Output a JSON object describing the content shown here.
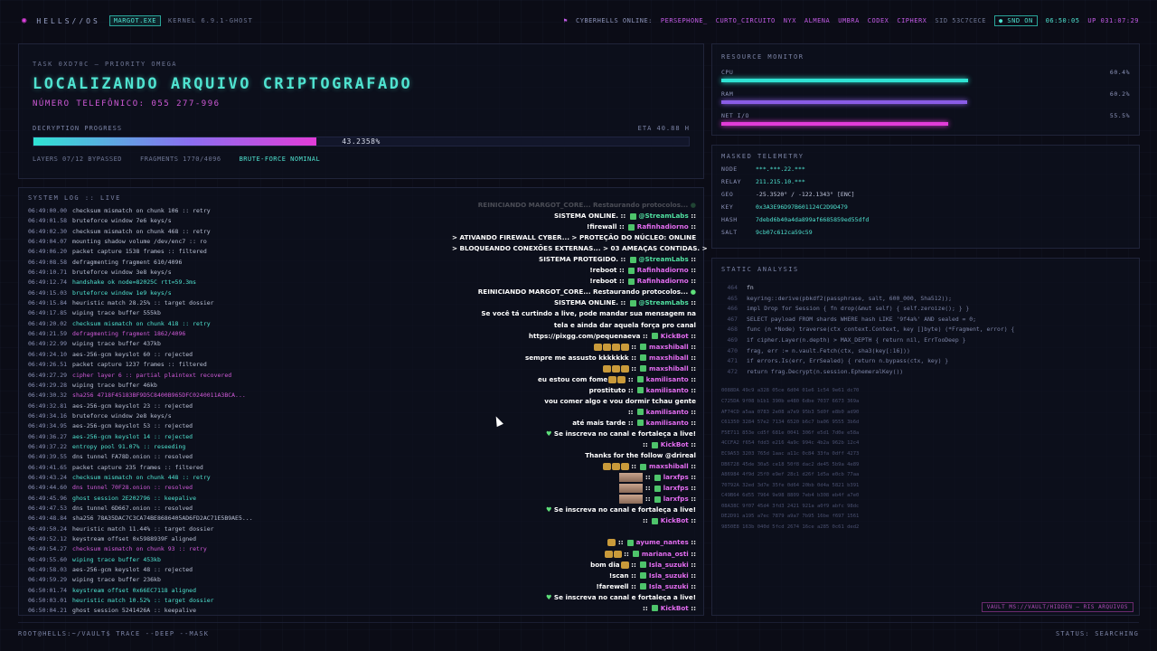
{
  "topbar": {
    "brand": "HELLS//OS",
    "process": "MARGOT.EXE",
    "kernel": "KERNEL 6.9.1-GHOST",
    "online_label": "CYBERHELLS ONLINE:",
    "users": [
      "PERSEPHONE_",
      "CURTO_CIRCUITO",
      "NYX",
      "ALMENA",
      "UMBRA",
      "CODEX",
      "CIPHERX"
    ],
    "sid": "SID 53C7CECE",
    "snd": "SND ON",
    "clock": "06:50:05",
    "uptime": "UP 031:07:29"
  },
  "task": {
    "id": "TASK 0XD70C — PRIORITY OMEGA",
    "headline": "LOCALIZANDO ARQUIVO CRIPTOGRAFADO",
    "phone": "NÚMERO TELEFÔNICO: 055 277-996",
    "progress_label": "DECRYPTION PROGRESS",
    "eta": "ETA 40.88 H",
    "progress_pct": 43.2358,
    "progress_text": "43.2358%",
    "layers": "LAYERS 07/12 BYPASSED",
    "fragments": "FRAGMENTS 1770/4096",
    "status": "BRUTE-FORCE NOMINAL"
  },
  "resources": {
    "title": "RESOURCE MONITOR",
    "items": [
      {
        "label": "CPU",
        "value": "60.4%",
        "level": 0.604,
        "color": "#2fe3d3"
      },
      {
        "label": "RAM",
        "value": "60.2%",
        "level": 0.602,
        "color": "#8a5ce6"
      },
      {
        "label": "NET I/O",
        "value": "55.5%",
        "level": 0.555,
        "color": "#e23cd8"
      }
    ]
  },
  "telemetry": {
    "title": "MASKED TELEMETRY",
    "rows": [
      {
        "key": "NODE",
        "value": "***.***.22.***"
      },
      {
        "key": "RELAY",
        "value": "211.215.10.***"
      },
      {
        "key": "GEO",
        "value": "-25.3520° / -122.1343° [ENC]"
      },
      {
        "key": "KEY",
        "value": "0x3A3E96D97B601124C2D9D479"
      },
      {
        "key": "HASH",
        "value": "7debd6b40a4da899af6685859ed55dfd"
      },
      {
        "key": "SALT",
        "value": "9cb07c612ca59c59"
      }
    ]
  },
  "static_analysis": {
    "title": "STATIC ANALYSIS",
    "lines": [
      {
        "n": "464",
        "t": "fn"
      },
      {
        "n": "465",
        "t": "keyring::derive(pbkdf2(passphrase, salt, 600_000, Sha512));"
      },
      {
        "n": "466",
        "t": "impl Drop for Session { fn drop(&mut self) { self.zeroize(); } }"
      },
      {
        "n": "467",
        "t": "SELECT payload FROM shards WHERE hash LIKE '9f4a%' AND sealed = 0;"
      },
      {
        "n": "468",
        "t": "func (n *Node) traverse(ctx context.Context, key []byte) (*Fragment, error) {"
      },
      {
        "n": "469",
        "t": "if cipher.Layer(n.depth) > MAX_DEPTH { return nil, ErrTooDeep }"
      },
      {
        "n": "470",
        "t": "frag, err := n.vault.Fetch(ctx, sha3(key[:16]))"
      },
      {
        "n": "471",
        "t": "if errors.Is(err, ErrSealed) { return n.bypass(ctx, key) }"
      },
      {
        "n": "472",
        "t": "return frag.Decrypt(n.session.EphemeralKey())"
      }
    ],
    "hex": [
      "0088DA 49c9 a328 05ce 6d04 01e6 1c54 9e61 dc70",
      "C725DA 9f08 b1b1 390b e480 6dbe 7037 6673 369a",
      "AF74CD a5aa 0783 2e08 a7e9 95b3 5d0f e8b0 ad90",
      "C61350 3284 57e2 7134 6520 b6c7 ba06 9555 3b6d",
      "F5E711 853e cd5f 681e 0041 306f e5d1 7d0e e58a",
      "4CCFA2 f654 fdd3 e216 4a9c 994c 4b2a 962b 12c4",
      "EC9A53 3203 765d 1aac a11c 0c84 33fa 0dff 4273",
      "DB6728 45de 30a5 ce18 50f8 dac2 de45 5b9a 4e89",
      "A86984 4f9d 25f0 e9ef 28c1 d26f 1d5a e0cb 77aa",
      "70792A 32ed 3d7e 35fe 0d64 20bb 0d4a 5821 b391",
      "C49B64 6d55 7964 9e98 8809 7eb4 b308 eb4f a7e0",
      "08A38C 9f07 45d4 3fd3 2421 921a a0f9 abfc 98dc",
      "DE2D91 a195 a7ec 7879 a9a7 7b95 16be f697 1561",
      "9850E8 163b 040d 5fcd 2674 16ce a285 0c61 ded2"
    ],
    "vault": "VAULT MS://VAULT/HIDDEN — RIS ARQUIVOS"
  },
  "system_log": {
    "title": "SYSTEM LOG :: LIVE",
    "rows": [
      {
        "ts": "06:49:00.00",
        "msg": "checksum mismatch on chunk 106 :: retry",
        "c": ""
      },
      {
        "ts": "06:49:01.58",
        "msg": "bruteforce window 7e6 keys/s",
        "c": ""
      },
      {
        "ts": "06:49:02.30",
        "msg": "checksum mismatch on chunk 468 :: retry",
        "c": ""
      },
      {
        "ts": "06:49:04.07",
        "msg": "mounting shadow volume /dev/enc7 :: ro",
        "c": ""
      },
      {
        "ts": "06:49:06.20",
        "msg": "packet capture 1538 frames :: filtered",
        "c": ""
      },
      {
        "ts": "06:49:08.58",
        "msg": "defragmenting fragment 610/4096",
        "c": ""
      },
      {
        "ts": "06:49:10.71",
        "msg": "bruteforce window 3e8 keys/s",
        "c": ""
      },
      {
        "ts": "06:49:12.74",
        "msg": "handshake ok node=82025C rtt=59.3ms",
        "c": "c"
      },
      {
        "ts": "06:49:15.03",
        "msg": "bruteforce window 1e9 keys/s",
        "c": "c"
      },
      {
        "ts": "06:49:15.84",
        "msg": "heuristic match 28.25% :: target dossier",
        "c": ""
      },
      {
        "ts": "06:49:17.85",
        "msg": "wiping trace buffer 555kb",
        "c": ""
      },
      {
        "ts": "06:49:20.02",
        "msg": "checksum mismatch on chunk 418 :: retry",
        "c": "c"
      },
      {
        "ts": "06:49:21.59",
        "msg": "defragmenting fragment 1862/4096",
        "c": "p"
      },
      {
        "ts": "06:49:22.99",
        "msg": "wiping trace buffer 437kb",
        "c": ""
      },
      {
        "ts": "06:49:24.10",
        "msg": "aes-256-gcm keyslot 60 :: rejected",
        "c": ""
      },
      {
        "ts": "06:49:26.51",
        "msg": "packet capture 1237 frames :: filtered",
        "c": ""
      },
      {
        "ts": "06:49:27.29",
        "msg": "cipher layer 6 :: partial plaintext recovered",
        "c": "p"
      },
      {
        "ts": "06:49:29.28",
        "msg": "wiping trace buffer 46kb",
        "c": ""
      },
      {
        "ts": "06:49:30.32",
        "msg": "sha256 4718F45183BF9D5C8400B965DFC0240011A3BCA...",
        "c": "p"
      },
      {
        "ts": "06:49:32.81",
        "msg": "aes-256-gcm keyslot 23 :: rejected",
        "c": ""
      },
      {
        "ts": "06:49:34.16",
        "msg": "bruteforce window 2e8 keys/s",
        "c": ""
      },
      {
        "ts": "06:49:34.95",
        "msg": "aes-256-gcm keyslot 53 :: rejected",
        "c": ""
      },
      {
        "ts": "06:49:36.27",
        "msg": "aes-256-gcm keyslot 14 :: rejected",
        "c": "c"
      },
      {
        "ts": "06:49:37.22",
        "msg": "entropy pool 91.07% :: reseeding",
        "c": "c"
      },
      {
        "ts": "06:49:39.55",
        "msg": "dns tunnel FA78D.onion :: resolved",
        "c": ""
      },
      {
        "ts": "06:49:41.65",
        "msg": "packet capture 235 frames :: filtered",
        "c": ""
      },
      {
        "ts": "06:49:43.24",
        "msg": "checksum mismatch on chunk 448 :: retry",
        "c": "c"
      },
      {
        "ts": "06:49:44.60",
        "msg": "dns tunnel 70F28.onion :: resolved",
        "c": "p"
      },
      {
        "ts": "06:49:45.96",
        "msg": "ghost session 2E202796 :: keepalive",
        "c": "c"
      },
      {
        "ts": "06:49:47.53",
        "msg": "dns tunnel 6D667.onion :: resolved",
        "c": ""
      },
      {
        "ts": "06:49:48.84",
        "msg": "sha256 78A35DAC7C3CA74BE8686405AD6FD2AC71E5B9AE5...",
        "c": ""
      },
      {
        "ts": "06:49:50.24",
        "msg": "heuristic match 11.44% :: target dossier",
        "c": ""
      },
      {
        "ts": "06:49:52.12",
        "msg": "keystream offset 0x5988939F aligned",
        "c": ""
      },
      {
        "ts": "06:49:54.27",
        "msg": "checksum mismatch on chunk 93 :: retry",
        "c": "p"
      },
      {
        "ts": "06:49:55.60",
        "msg": "wiping trace buffer 453kb",
        "c": "c"
      },
      {
        "ts": "06:49:58.03",
        "msg": "aes-256-gcm keyslot 48 :: rejected",
        "c": ""
      },
      {
        "ts": "06:49:59.29",
        "msg": "wiping trace buffer 236kb",
        "c": ""
      },
      {
        "ts": "06:50:01.74",
        "msg": "keystream offset 0x66EC7118 aligned",
        "c": "c"
      },
      {
        "ts": "06:50:03.01",
        "msg": "heuristic match 10.52% :: target dossier",
        "c": "c"
      },
      {
        "ts": "06:50:04.21",
        "msg": "ghost session 5241426A :: keepalive",
        "c": ""
      }
    ]
  },
  "chat": [
    {
      "text": "REINICIANDO MARGOT_CORE... Restaurando protocolos...",
      "user": "",
      "faded": true,
      "dot": true
    },
    {
      "text": "SISTEMA ONLINE.",
      "user": "@StreamLabs",
      "faded": false,
      "g": true
    },
    {
      "text": "!firewall",
      "user": "Rafinhadiorno",
      "faded": false
    },
    {
      "text": "> ATIVANDO FIREWALL CYBER... > PROTEÇÃO DO NÚCLEO: ONLINE",
      "user": "",
      "faded": false
    },
    {
      "text": "> BLOQUEANDO CONEXÕES EXTERNAS... > 03 AMEAÇAS CONTIDAS. >",
      "user": "",
      "faded": false
    },
    {
      "text": "SISTEMA PROTEGIDO.",
      "user": "@StreamLabs",
      "faded": false,
      "g": true
    },
    {
      "text": "!reboot",
      "user": "Rafinhadiorno",
      "faded": false
    },
    {
      "text": "!reboot",
      "user": "Rafinhadiorno",
      "faded": false
    },
    {
      "text": "REINICIANDO MARGOT_CORE... Restaurando protocolos...",
      "user": "",
      "faded": false,
      "dot": true
    },
    {
      "text": "SISTEMA ONLINE.",
      "user": "@StreamLabs",
      "faded": false,
      "g": true
    },
    {
      "text": "Se você tá curtindo a live, pode mandar sua mensagem na",
      "user": "",
      "faded": false
    },
    {
      "text": "tela e ainda dar aquela força pro canal",
      "user": "",
      "faded": false
    },
    {
      "text": "https://pixgg.com/pequenaeva",
      "user": "KickBot",
      "faded": false
    },
    {
      "text": "",
      "user": "maxshiball",
      "faded": false,
      "emotes": 4
    },
    {
      "text": "sempre me assusto kkkkkkk",
      "user": "maxshiball",
      "faded": false
    },
    {
      "text": "",
      "user": "maxshiball",
      "faded": false,
      "emotes": 3
    },
    {
      "text": "eu estou com fome",
      "user": "kamilisanto",
      "faded": false,
      "emotes": 2
    },
    {
      "text": "prostituto",
      "user": "kamilisanto",
      "faded": false
    },
    {
      "text": "vou comer algo e vou dormir tchau gente",
      "user": "",
      "faded": false
    },
    {
      "text": "",
      "user": "kamilisanto",
      "faded": false
    },
    {
      "text": "até mais tarde",
      "user": "kamilisanto",
      "faded": false
    },
    {
      "text": "Se inscreva no canal e fortaleça a live!",
      "user": "",
      "faded": false,
      "heart": true
    },
    {
      "text": "",
      "user": "KickBot",
      "faded": false
    },
    {
      "text": "Thanks for the follow @drireal",
      "user": "",
      "faded": false
    },
    {
      "text": "",
      "user": "maxshiball",
      "faded": false,
      "emotes": 3
    },
    {
      "text": "",
      "user": "larxfps",
      "faded": false,
      "photo": true
    },
    {
      "text": "",
      "user": "larxfps",
      "faded": false,
      "photo": true
    },
    {
      "text": "",
      "user": "larxfps",
      "faded": false,
      "photo": true
    },
    {
      "text": "Se inscreva no canal e fortaleça a live!",
      "user": "",
      "faded": false,
      "heart": true
    },
    {
      "text": "",
      "user": "KickBot",
      "faded": false
    },
    {
      "text": "",
      "user": "",
      "faded": false
    },
    {
      "text": "",
      "user": "ayume_nantes",
      "faded": false,
      "emotes": 1
    },
    {
      "text": "",
      "user": "mariana_osti",
      "faded": false,
      "emotes": 2
    },
    {
      "text": "bom dia",
      "user": "Isla_suzuki",
      "faded": false,
      "emotes": 1
    },
    {
      "text": "!scan",
      "user": "Isla_suzuki",
      "faded": false
    },
    {
      "text": "!farewell",
      "user": "Isla_suzuki",
      "faded": false
    },
    {
      "text": "Se inscreva no canal e fortaleça a live!",
      "user": "",
      "faded": false,
      "heart": true
    },
    {
      "text": "",
      "user": "KickBot",
      "faded": false
    }
  ],
  "footer": {
    "prompt": "ROOT@HELLS:~/VAULT$ TRACE --DEEP --MASK",
    "status": "STATUS: SEARCHING"
  }
}
